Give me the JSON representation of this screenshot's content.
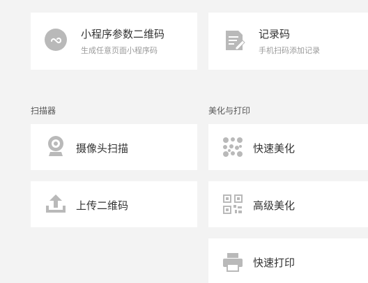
{
  "cards": {
    "mini_program_qr": {
      "title": "小程序参数二维码",
      "subtitle": "生成任意页面小程序码"
    },
    "record_code": {
      "title": "记录码",
      "subtitle": "手机扫码添加记录"
    },
    "camera_scan": {
      "title": "摄像头扫描"
    },
    "upload_qr": {
      "title": "上传二维码"
    },
    "quick_beautify": {
      "title": "快速美化"
    },
    "advanced_beautify": {
      "title": "高级美化"
    },
    "quick_print": {
      "title": "快速打印"
    }
  },
  "sections": {
    "scanner": "扫描器",
    "beautify_print": "美化与打印"
  },
  "icons": {
    "mini_program": "mini-program-icon",
    "record": "record-icon",
    "camera": "webcam-icon",
    "upload": "upload-icon",
    "quick_beautify": "qr-beautify-icon",
    "advanced_beautify": "qr-advanced-icon",
    "print": "printer-icon"
  },
  "colors": {
    "background": "#f3f3f3",
    "card": "#ffffff",
    "icon": "#b9b9b9",
    "title": "#333333",
    "subtitle": "#9a9a9a"
  }
}
